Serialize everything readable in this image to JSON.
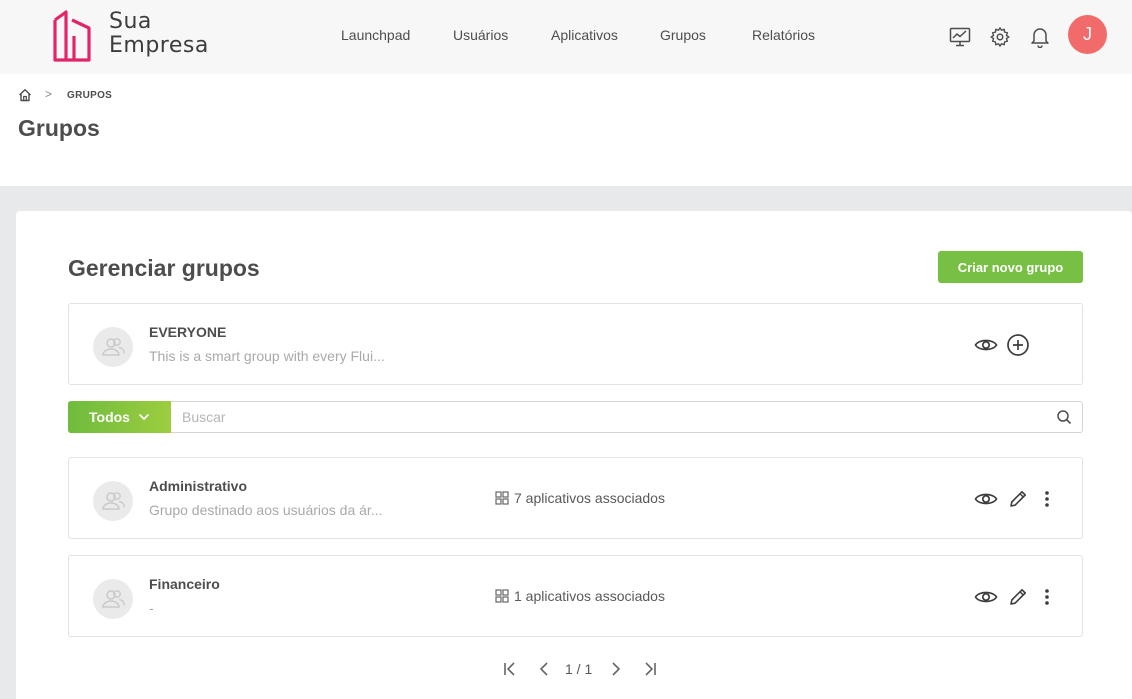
{
  "brand": {
    "line1": "Sua",
    "line2": "Empresa",
    "accent": "#e2256b"
  },
  "nav": [
    "Launchpad",
    "Usuários",
    "Aplicativos",
    "Grupos",
    "Relatórios"
  ],
  "header_icons": [
    "monitor-chart-icon",
    "gear-icon",
    "bell-icon"
  ],
  "user": {
    "initial": "J",
    "color": "#f26b6b"
  },
  "breadcrumb": {
    "current": "GRUPOS"
  },
  "page": {
    "title": "Grupos"
  },
  "card": {
    "title": "Gerenciar grupos",
    "create_label": "Criar novo grupo"
  },
  "everyone": {
    "name": "EVERYONE",
    "description": "This is a smart group with every Flui..."
  },
  "filter": {
    "selected": "Todos",
    "placeholder": "Buscar"
  },
  "groups": [
    {
      "name": "Administrativo",
      "description": "Grupo destinado aos usuários da ár...",
      "apps": "7 aplicativos associados"
    },
    {
      "name": "Financeiro",
      "description": "-",
      "apps": "1 aplicativos associados"
    }
  ],
  "pagination": {
    "text": "1 / 1"
  },
  "colors": {
    "primary_green": "#77c043",
    "page_bg": "#e8e9ea"
  }
}
